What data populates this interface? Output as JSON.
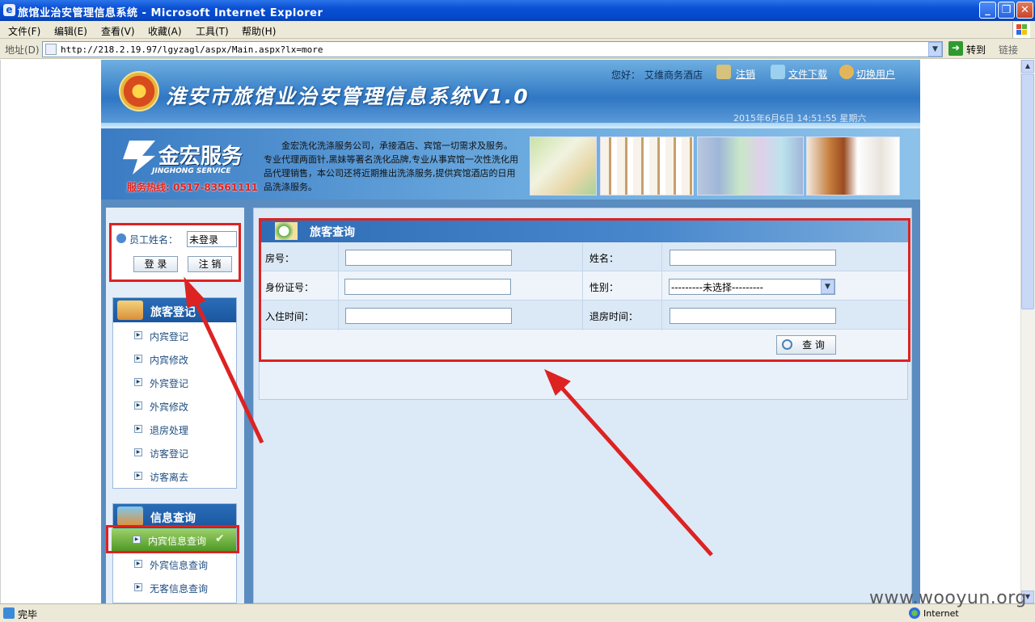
{
  "window": {
    "title": "旅馆业治安管理信息系统 - Microsoft Internet Explorer"
  },
  "menu": [
    "文件(F)",
    "编辑(E)",
    "查看(V)",
    "收藏(A)",
    "工具(T)",
    "帮助(H)"
  ],
  "address": {
    "label": "地址(D)",
    "url": "http://218.2.19.97/lgyzagl/aspx/Main.aspx?lx=more",
    "go": "转到",
    "links": "链接"
  },
  "header": {
    "title": "淮安市旅馆业治安管理信息系统V1.0",
    "greeting": "您好：",
    "hotel": "艾维商务酒店",
    "logout": "注销",
    "download": "文件下载",
    "switch_user": "切换用户",
    "datetime": "2015年6月6日 14:51:55 星期六"
  },
  "banner": {
    "brand": "金宏服务",
    "brand_en": "JINGHONG SERVICE",
    "hotline": "服务热线: 0517-83561111",
    "description": "金宏洗化洗涤服务公司，承接酒店、宾馆一切需求及服务。专业代理两面针,黑妹等著名洗化品牌,专业从事宾馆一次性洗化用品代理销售，本公司还将近期推出洗涤服务,提供宾馆酒店的日用品洗涤服务。"
  },
  "login": {
    "name_label": "员工姓名：",
    "name_value": "未登录",
    "login_btn": "登 录",
    "logout_btn": "注 销"
  },
  "guest_reg": {
    "title": "旅客登记",
    "items": [
      "内宾登记",
      "内宾修改",
      "外宾登记",
      "外宾修改",
      "退房处理",
      "访客登记",
      "访客离去"
    ]
  },
  "info_query": {
    "title": "信息查询",
    "items": [
      "内宾信息查询",
      "外宾信息查询",
      "无客信息查询"
    ]
  },
  "search": {
    "title": "旅客查询",
    "room_label": "房号：",
    "name_label": "姓名：",
    "id_label": "身份证号：",
    "gender_label": "性别：",
    "gender_value": "---------未选择---------",
    "checkin_label": "入住时间：",
    "checkout_label": "退房时间：",
    "query_btn": "查 询"
  },
  "status": {
    "left": "完毕",
    "zone": "Internet"
  },
  "watermark": "www.wooyun.org",
  "colors": {
    "annotation_red": "#dd2222",
    "panel_blue": "#2a6db7"
  }
}
